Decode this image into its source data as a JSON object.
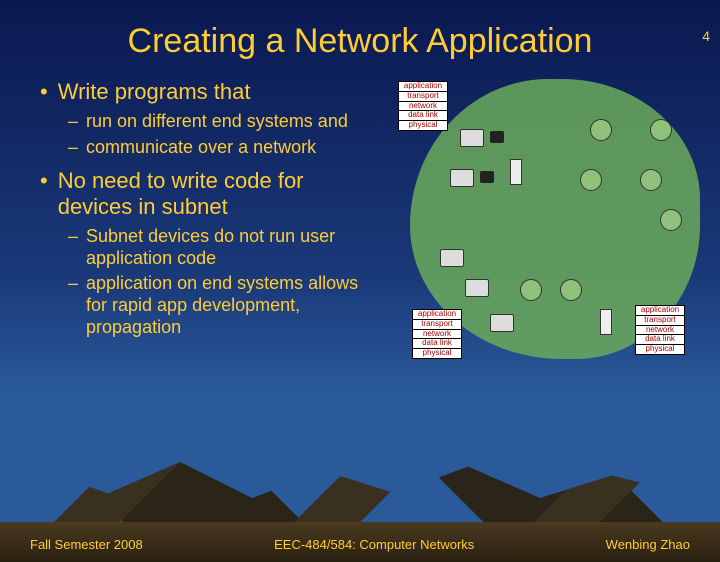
{
  "page_number": "4",
  "title": "Creating a Network Application",
  "bullets": {
    "main1": "Write programs that",
    "sub1a": "run on different end systems and",
    "sub1b": "communicate over a network",
    "main2": "No need to write code for devices in subnet",
    "sub2a": "Subnet devices do not run user application code",
    "sub2b": "application on end systems allows for rapid app development, propagation"
  },
  "layers": {
    "l1": "application",
    "l2": "transport",
    "l3": "network",
    "l4": "data link",
    "l5": "physical"
  },
  "footer": {
    "left": "Fall Semester 2008",
    "center": "EEC-484/584: Computer Networks",
    "right": "Wenbing Zhao"
  }
}
